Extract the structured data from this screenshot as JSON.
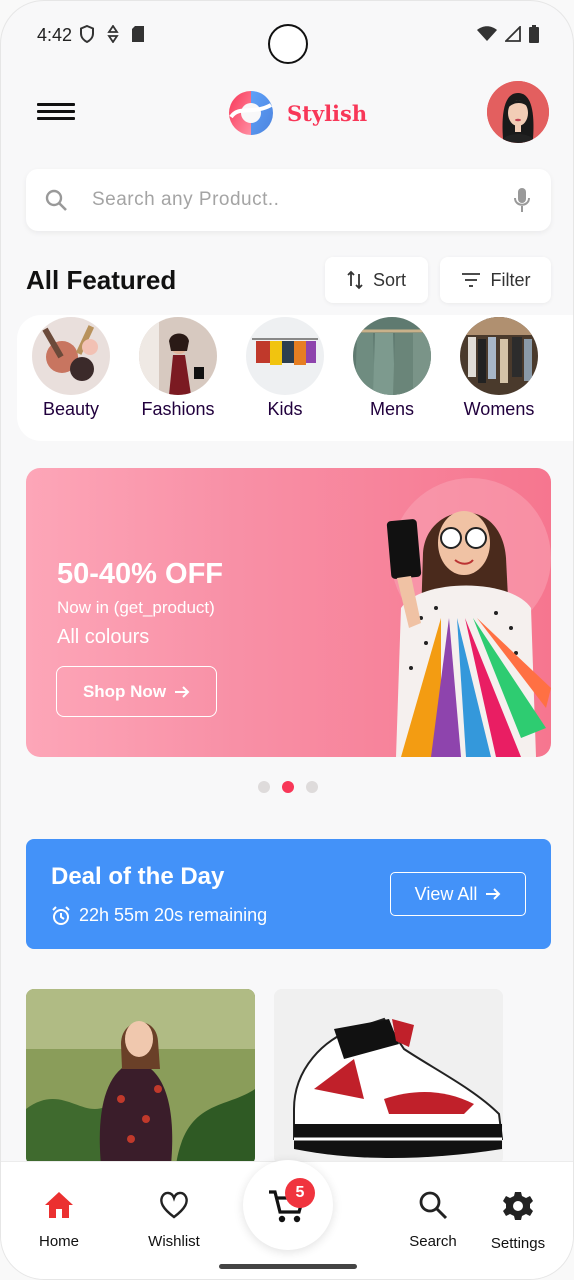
{
  "status_bar": {
    "time": "4:42",
    "icons": [
      "shield-icon",
      "data-saver-icon",
      "sd-card-icon",
      "wifi-icon",
      "signal-icon",
      "battery-icon"
    ]
  },
  "header": {
    "logo_text": "Stylish",
    "menu_icon": "hamburger-icon",
    "avatar": "profile-avatar"
  },
  "search": {
    "placeholder": "Search any Product..",
    "value": "",
    "icons": [
      "search-icon",
      "mic-icon"
    ]
  },
  "featured": {
    "title": "All Featured",
    "sort_label": "Sort",
    "filter_label": "Filter"
  },
  "categories": [
    {
      "label": "Beauty"
    },
    {
      "label": "Fashions"
    },
    {
      "label": "Kids"
    },
    {
      "label": "Mens"
    },
    {
      "label": "Womens"
    }
  ],
  "banner": {
    "headline": "50-40% OFF",
    "line1": "Now in (get_product)",
    "line2": "All colours",
    "button": "Shop Now"
  },
  "carousel": {
    "count": 3,
    "active_index": 1
  },
  "deal": {
    "title": "Deal of the Day",
    "timer": "22h 55m 20s remaining",
    "button": "View All"
  },
  "nav": {
    "items": [
      {
        "label": "Home",
        "icon": "home-icon"
      },
      {
        "label": "Wishlist",
        "icon": "heart-icon"
      },
      {
        "label": "Search",
        "icon": "search-icon"
      },
      {
        "label": "Settings",
        "icon": "gear-icon"
      }
    ],
    "cart_count": "5"
  },
  "colors": {
    "brand": "#f83758",
    "deal_blue": "#4392f9",
    "home_active": "#eb3030"
  }
}
